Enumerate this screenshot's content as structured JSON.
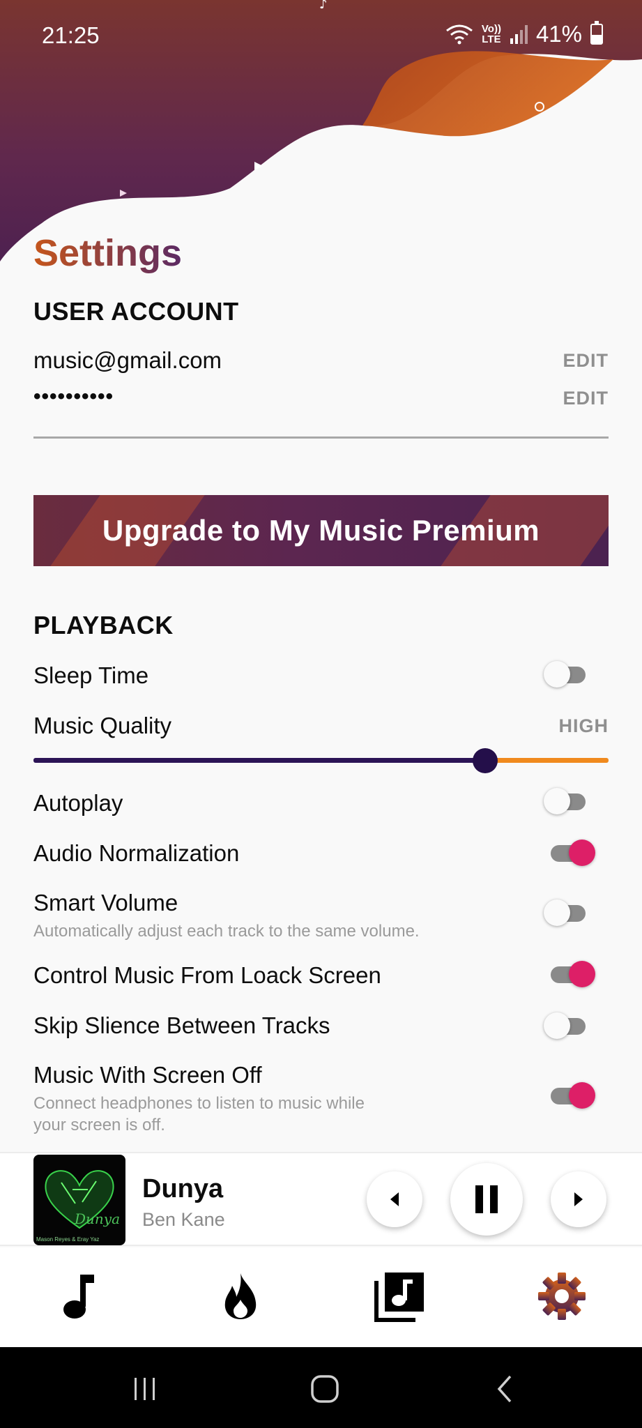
{
  "status_bar": {
    "time": "21:25",
    "volte_top": "Vo))",
    "volte_bottom": "LTE",
    "battery": "41%"
  },
  "page": {
    "title": "Settings"
  },
  "user_account": {
    "heading": "USER ACCOUNT",
    "email": "music@gmail.com",
    "password": "••••••••••",
    "edit_label": "EDIT"
  },
  "premium": {
    "label": "Upgrade to My Music Premium"
  },
  "playback": {
    "heading": "PLAYBACK",
    "sleep_time": {
      "label": "Sleep Time",
      "enabled": false
    },
    "music_quality": {
      "label": "Music Quality",
      "value": "HIGH",
      "slider_fraction": 0.786
    },
    "autoplay": {
      "label": "Autoplay",
      "enabled": false
    },
    "audio_normalization": {
      "label": "Audio Normalization",
      "enabled": true
    },
    "smart_volume": {
      "label": "Smart Volume",
      "description": "Automatically adjust each track to the same volume.",
      "enabled": false
    },
    "lock_screen": {
      "label": "Control Music From Loack Screen",
      "enabled": true
    },
    "skip_silence": {
      "label": "Skip Slience Between Tracks",
      "enabled": false
    },
    "screen_off": {
      "label": "Music With Screen Off",
      "description_line1": "Connect headphones to listen to music while",
      "description_line2": "your screen is off.",
      "enabled": true
    }
  },
  "now_playing": {
    "title": "Dunya",
    "artist": "Ben Kane",
    "album_art_text": "Dunya",
    "album_art_subtext": "Mason Reyes & Eray Yaz"
  },
  "bottom_nav": {
    "items": [
      "music-note-icon",
      "fire-icon",
      "library-icon",
      "gear-icon"
    ],
    "active_index": 3
  },
  "colors": {
    "accent_pink": "#dd1f67",
    "slider_dark": "#2c1456",
    "slider_orange": "#f08a1e",
    "header_orange": "#c5561c",
    "header_purple": "#4b2250"
  }
}
